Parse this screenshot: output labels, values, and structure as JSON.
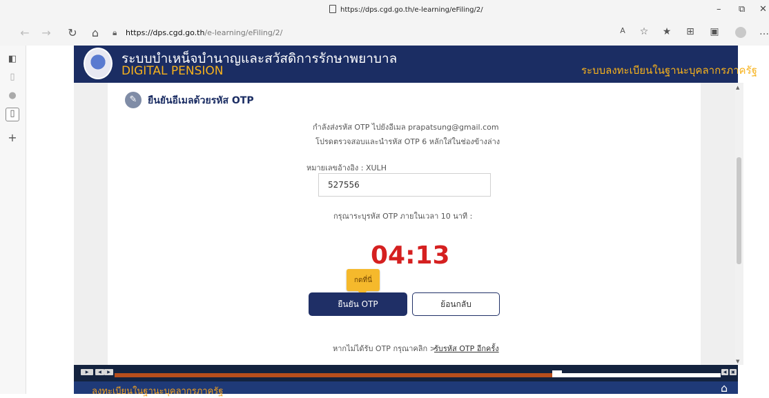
{
  "browser": {
    "title_url": "https://dps.cgd.go.th/e-learning/eFiling/2/",
    "address_host": "https://dps.cgd.go.th",
    "address_path": "/e-learning/eFiling/2/",
    "icons": [
      "back-icon",
      "forward-icon",
      "refresh-icon",
      "home-icon",
      "read-aloud-icon",
      "favorite-add-icon",
      "favorites-icon",
      "collections-icon",
      "screenshot-icon",
      "profile-icon"
    ]
  },
  "site": {
    "title": "ระบบบำเหน็จบำนาญและสวัสดิการรักษาพยาบาล",
    "subtitle": "DIGITAL PENSION",
    "right_text": "ระบบลงทะเบียนในฐานะบุคลากรภาครัฐ"
  },
  "section": {
    "title": "ยืนยันอีเมลด้วยรหัส OTP",
    "icon": "pencil-icon"
  },
  "otp": {
    "line1": "กำลังส่งรหัส OTP ไปยังอีเมล prapatsung@gmail.com",
    "line2": "โปรดตรวจสอบและนำรหัส OTP 6 หลักใส่ในช่องข้างล่าง",
    "ref_label": "หมายเลขอ้างอิง : XULH",
    "value": "527556",
    "prompt": "กรุณาระบุรหัส OTP ภายในเวลา 10 นาที :",
    "timer": "04:13",
    "tooltip": "กดที่นี่",
    "confirm": "ยืนยัน OTP",
    "back": "ย้อนกลับ",
    "resend_text": "หากไม่ได้รับ OTP กรุณาคลิก >",
    "resend_link": "รับรหัส OTP อีกครั้ง"
  },
  "player": {
    "progress": 0.73
  },
  "footer": {
    "text": "ลงทะเบียนในฐานะบุคลากรภาครัฐ"
  },
  "colors": {
    "header_bg": "#1b2d63",
    "accent_gold": "#f7b21c",
    "timer_red": "#d52020",
    "confirm_btn": "#1f2f66",
    "progress_fill": "#b84e1c"
  }
}
